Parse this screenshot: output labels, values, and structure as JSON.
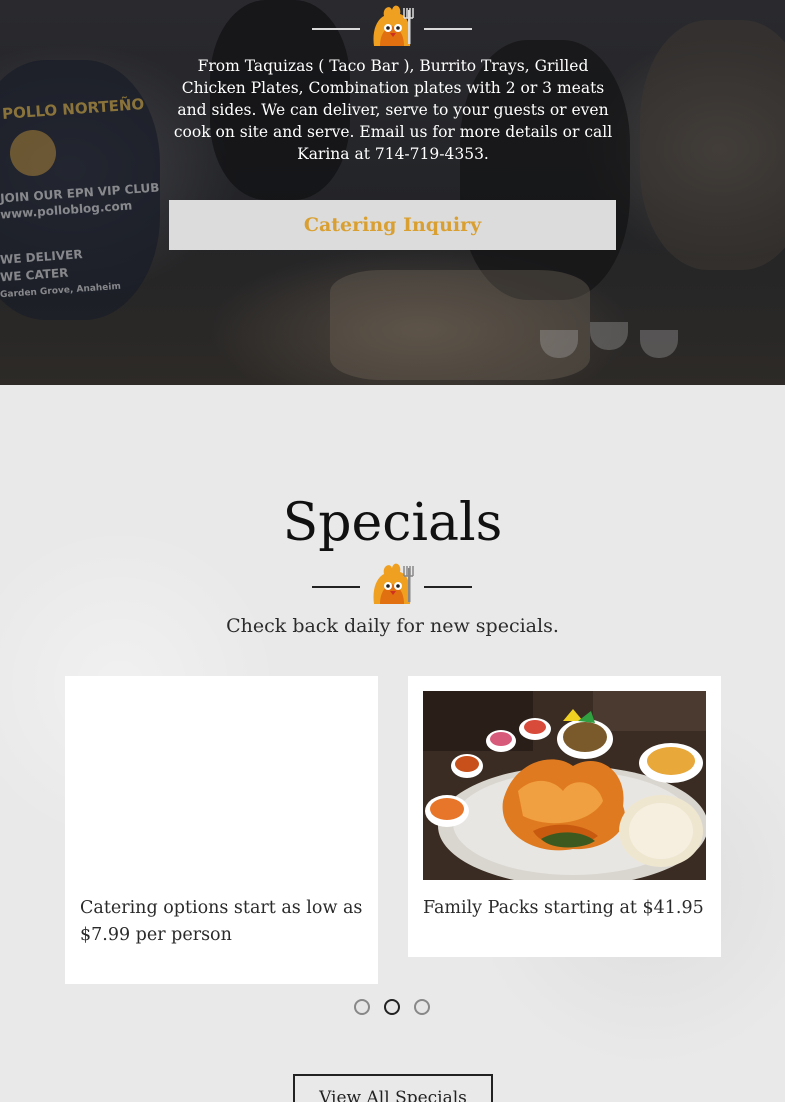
{
  "catering": {
    "description": "From Taquizas ( Taco Bar ), Burrito Trays, Grilled Chicken Plates, Combination plates with 2 or 3 meats and sides. We can deliver, serve to your guests or even cook on site and serve. Email us for more details or call Karina at 714-719-4353.",
    "button_label": "Catering Inquiry",
    "background_sign_text": [
      "POLLO NORTEÑO",
      "JOIN OUR EPN VIP CLUB",
      "www.polloblog.com",
      "WE DELIVER",
      "WE CATER",
      "Garden Grove, Anaheim"
    ]
  },
  "specials": {
    "title": "Specials",
    "subtitle": "Check back daily for new specials.",
    "cards": [
      {
        "caption": "Catering options start as low as $7.99 per person",
        "image": "blank"
      },
      {
        "caption": "Family Packs starting at $41.95",
        "image": "grilled-chicken-plate-photo"
      }
    ],
    "carousel": {
      "count": 3,
      "active_index": 1
    },
    "view_all_label": "View All Specials"
  },
  "divider_icon": "chicken-mascot-with-fork-icon",
  "colors": {
    "accent": "#d9a031",
    "hero_overlay": "#232427",
    "section_bg": "#e9e9e9",
    "text_dark": "#111111"
  }
}
